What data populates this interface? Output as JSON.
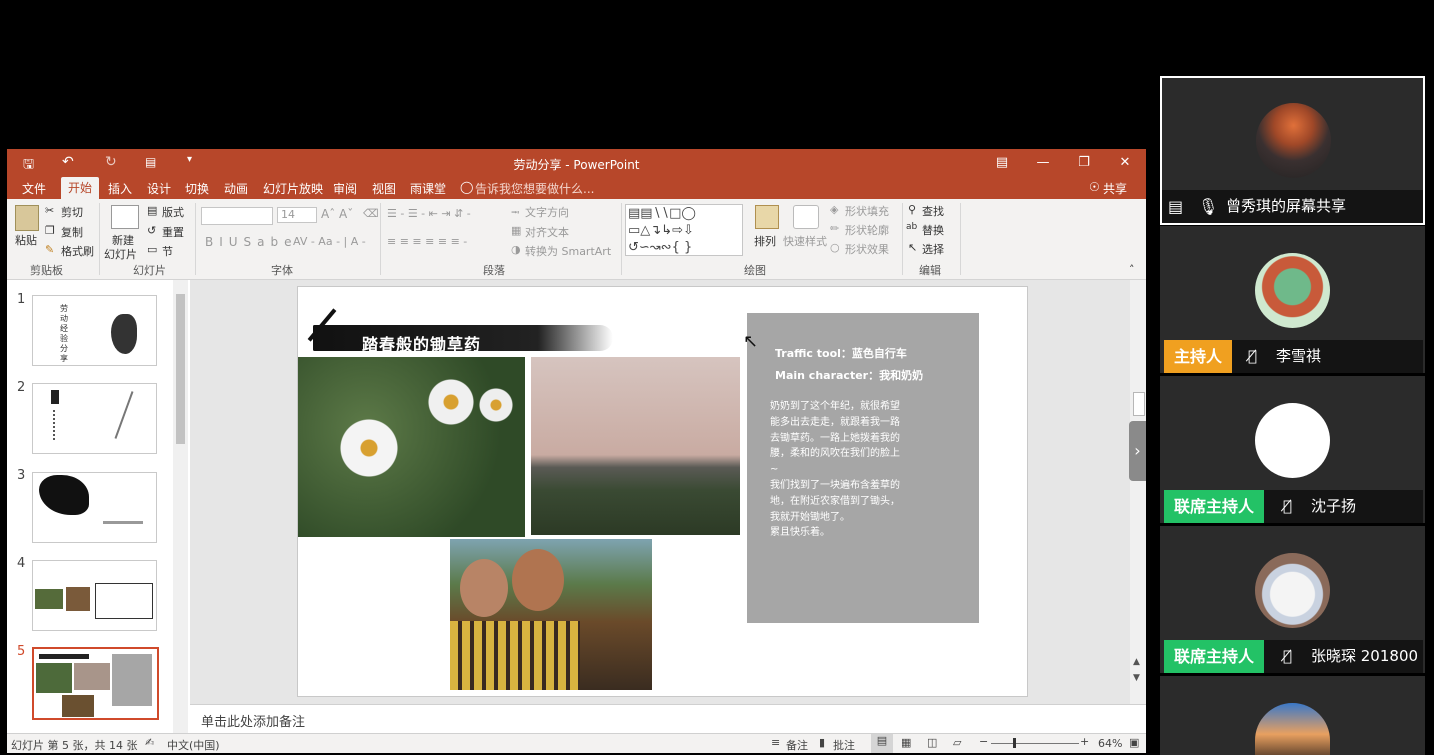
{
  "window": {
    "title": "劳动分享 - PowerPoint"
  },
  "tabs": [
    "文件",
    "开始",
    "插入",
    "设计",
    "切换",
    "动画",
    "幻灯片放映",
    "审阅",
    "视图",
    "雨课堂"
  ],
  "active_tab": "开始",
  "tell_me": "告诉我您想要做什么...",
  "share_label": "共享",
  "ribbon": {
    "clipboard": {
      "paste": "粘贴",
      "cut": "剪切",
      "copy": "复制",
      "format_painter": "格式刷",
      "label": "剪贴板"
    },
    "slides": {
      "new_slide_line1": "新建",
      "new_slide_line2": "幻灯片",
      "layout": "版式",
      "reset": "重置",
      "section": "节",
      "label": "幻灯片"
    },
    "font": {
      "font_size": "14",
      "label": "字体"
    },
    "paragraph": {
      "text_direction": "文字方向",
      "align_text": "对齐文本",
      "smartart": "转换为 SmartArt",
      "label": "段落"
    },
    "drawing": {
      "arrange": "排列",
      "quick_styles": "快速样式",
      "shape_fill": "形状填充",
      "shape_outline": "形状轮廓",
      "shape_effects": "形状效果",
      "label": "绘图"
    },
    "editing": {
      "find": "查找",
      "replace": "替换",
      "select": "选择",
      "label": "编辑"
    }
  },
  "thumbs": [
    {
      "num": "1",
      "text": "劳动经验分享"
    },
    {
      "num": "2",
      "text": ""
    },
    {
      "num": "3",
      "text": ""
    },
    {
      "num": "4",
      "text": ""
    },
    {
      "num": "5",
      "text": ""
    }
  ],
  "slide": {
    "title": "踏春般的锄草药",
    "traffic": "Traffic tool：蓝色自行车",
    "character": "Main character：我和奶奶",
    "body": [
      "奶奶到了这个年纪，就很希望",
      "能多出去走走，就跟着我一路",
      "去锄草药。一路上她拨着我的",
      "腰，柔和的风吹在我们的脸上",
      "~",
      "我们找到了一块遍布含羞草的",
      "地，在附近农家借到了锄头，",
      "我就开始锄地了。",
      "累且快乐着。"
    ]
  },
  "notes_placeholder": "单击此处添加备注",
  "status": {
    "slide_info": "幻灯片 第 5 张，共 14 张",
    "language": "中文(中国)",
    "notes": "备注",
    "comments": "批注",
    "zoom": "64%"
  },
  "participants": [
    {
      "name": "曾秀琪的屏幕共享",
      "role": ""
    },
    {
      "name": "李雪祺",
      "role": "主持人"
    },
    {
      "name": "沈子扬",
      "role": "联席主持人"
    },
    {
      "name": "张晓琛 201800",
      "role": "联席主持人"
    }
  ],
  "colors": {
    "ppt_accent": "#b7472a",
    "host_badge": "#f0a020",
    "cohost_badge": "#23c266"
  }
}
